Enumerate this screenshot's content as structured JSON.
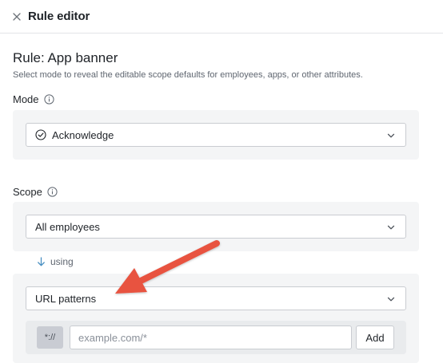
{
  "header": {
    "title": "Rule editor",
    "close_icon": "close-icon"
  },
  "rule": {
    "title": "Rule: App banner",
    "description": "Select mode to reveal the editable scope defaults for employees, apps, or other attributes."
  },
  "mode": {
    "label": "Mode",
    "selected": "Acknowledge",
    "selected_icon": "check-circle-icon"
  },
  "scope": {
    "label": "Scope",
    "selected": "All employees",
    "using_text": "using",
    "attribute_selected": "URL patterns",
    "url_prefix": "*://",
    "url_placeholder": "example.com/*",
    "add_label": "Add"
  },
  "annotation": {
    "type": "arrow",
    "color": "#e8523f"
  },
  "colors": {
    "panel_bg": "#f4f5f6",
    "border": "#c9ccd1",
    "muted_text": "#5f6670",
    "accent_arrow": "#4a90c2"
  }
}
